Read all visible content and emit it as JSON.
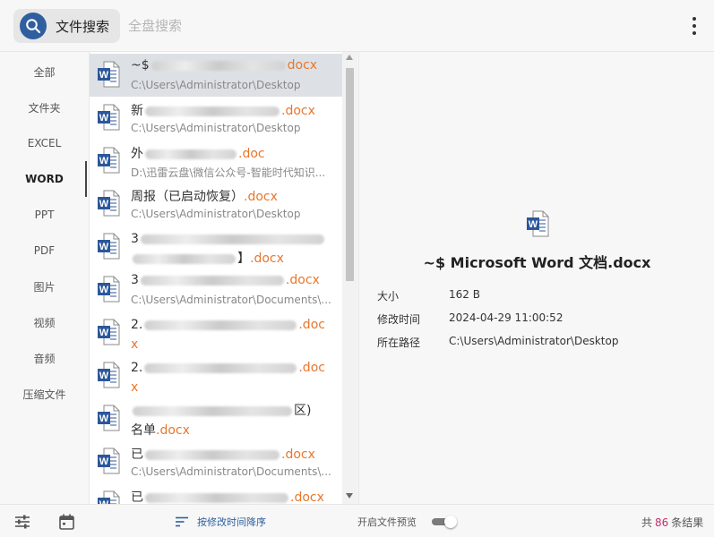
{
  "colors": {
    "accent": "#2f5f9e",
    "extension": "#e8762d",
    "count": "#c0306b",
    "selected_row": "#dde1e6"
  },
  "header": {
    "search_mode_label": "文件搜索",
    "all_disk_placeholder": "全盘搜索",
    "search_icon": "magnifier-icon",
    "more_icon": "vertical-ellipsis-icon"
  },
  "sidebar": {
    "items": [
      {
        "label": "全部"
      },
      {
        "label": "文件夹"
      },
      {
        "label": "EXCEL"
      },
      {
        "label": "WORD",
        "active": true
      },
      {
        "label": "PPT"
      },
      {
        "label": "PDF"
      },
      {
        "label": "图片"
      },
      {
        "label": "视频"
      },
      {
        "label": "音频"
      },
      {
        "label": "压缩文件"
      }
    ]
  },
  "file_list": {
    "rows": [
      {
        "name_start": "~$",
        "ext": "docx",
        "path": "C:\\Users\\Administrator\\Desktop",
        "selected": true
      },
      {
        "name_start": "新",
        "ext": ".docx",
        "path": "C:\\Users\\Administrator\\Desktop"
      },
      {
        "name_start": "外",
        "ext": ".doc",
        "path": "D:\\迅雷云盘\\微信公众号-智能时代知识..."
      },
      {
        "name_start": "周报（已启动恢复）",
        "ext": ".docx",
        "path": "C:\\Users\\Administrator\\Desktop"
      },
      {
        "name_start": "3",
        "name_line2_end": "】",
        "ext": ".docx"
      },
      {
        "name_start": "3",
        "ext": ".docx",
        "path": "C:\\Users\\Administrator\\Documents\\..."
      },
      {
        "name_start": "2.",
        "ext_a": ".doc",
        "ext_b": "x"
      },
      {
        "name_start": "2.",
        "ext_a": ".doc",
        "ext_b": "x"
      },
      {
        "name_line1_end": "区)",
        "name_line2_start": "名单",
        "ext": ".docx"
      },
      {
        "name_start": "已",
        "ext": ".docx",
        "path": "C:\\Users\\Administrator\\Documents\\..."
      },
      {
        "name_start": "已",
        "ext": ".docx"
      }
    ]
  },
  "preview": {
    "title": "~$ Microsoft Word 文档.docx",
    "size_label": "大小",
    "size_value": "162 B",
    "modified_label": "修改时间",
    "modified_value": "2024-04-29 11:00:52",
    "path_label": "所在路径",
    "path_value": "C:\\Users\\Administrator\\Desktop"
  },
  "footer": {
    "filter_icon": "sliders-icon",
    "calendar_icon": "calendar-icon",
    "sort_label": "按修改时间降序",
    "preview_toggle_label": "开启文件预览",
    "preview_toggle_on": true,
    "count_prefix": "共",
    "count_value": "86",
    "count_suffix": "条结果"
  }
}
